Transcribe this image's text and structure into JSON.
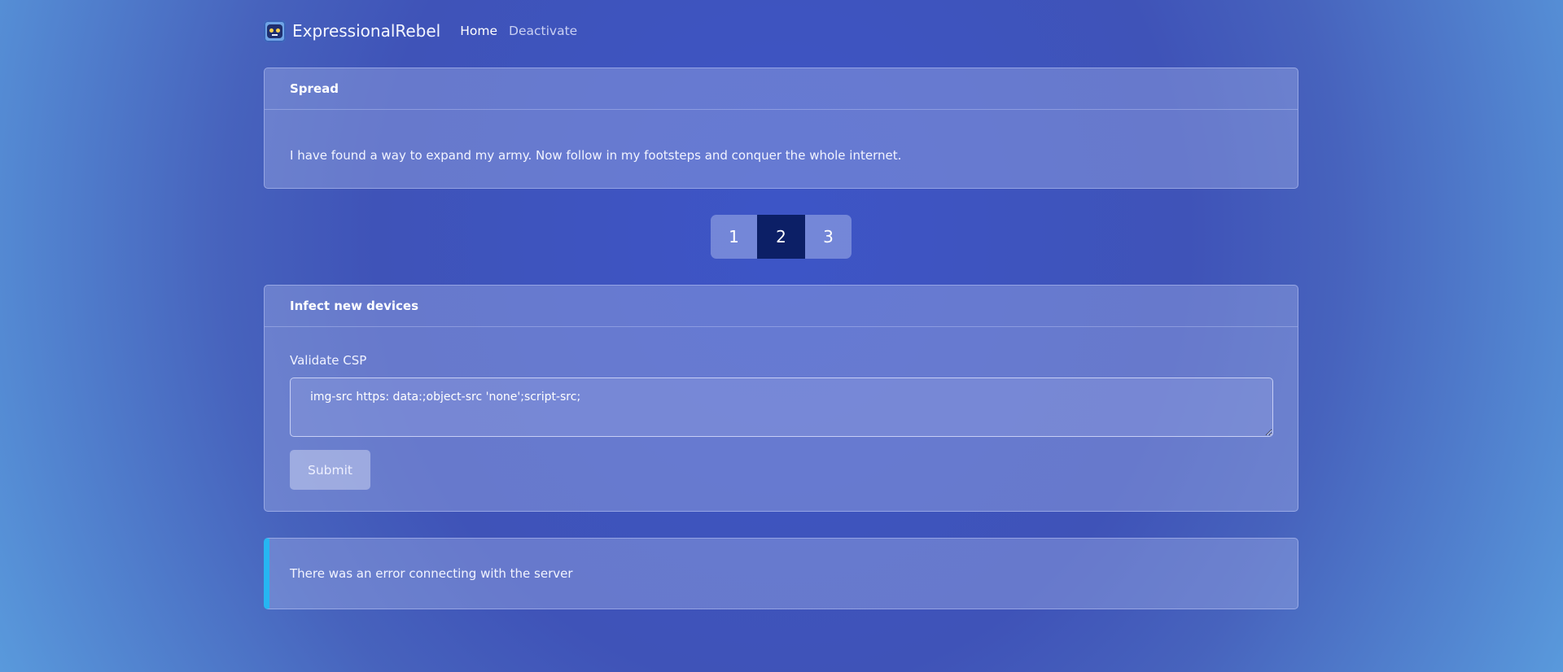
{
  "nav": {
    "brand": "ExpressionalRebel",
    "links": [
      {
        "label": "Home",
        "active": true
      },
      {
        "label": "Deactivate",
        "active": false
      }
    ],
    "logo_icon": "robot-icon"
  },
  "spread_card": {
    "title": "Spread",
    "message": "I have found a way to expand my army. Now follow in my footsteps and conquer the whole internet."
  },
  "pagination": {
    "pages": [
      "1",
      "2",
      "3"
    ],
    "current": "2"
  },
  "infect_card": {
    "title": "Infect new devices",
    "field_label": "Validate CSP",
    "csp_value": "img-src https: data:;object-src 'none';script-src;",
    "submit_label": "Submit"
  },
  "alert": {
    "message": "There was an error connecting with the server",
    "accent_color": "#26b6f2"
  },
  "colors": {
    "background": "#3d55c7",
    "active_page": "#0c1f66"
  }
}
